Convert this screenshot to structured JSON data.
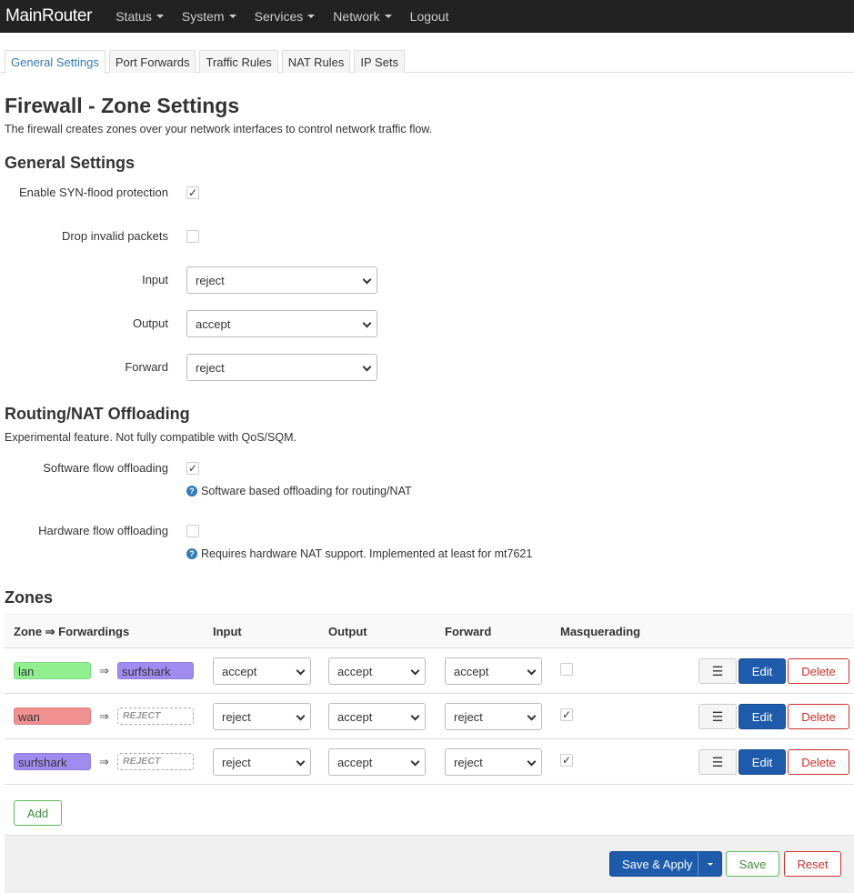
{
  "nav": {
    "brand": "MainRouter",
    "items": [
      "Status",
      "System",
      "Services",
      "Network",
      "Logout"
    ]
  },
  "tabs": [
    "General Settings",
    "Port Forwards",
    "Traffic Rules",
    "NAT Rules",
    "IP Sets"
  ],
  "page": {
    "title": "Firewall - Zone Settings",
    "description": "The firewall creates zones over your network interfaces to control network traffic flow."
  },
  "general": {
    "heading": "General Settings",
    "syn_label": "Enable SYN-flood protection",
    "syn_checked": true,
    "drop_label": "Drop invalid packets",
    "drop_checked": false,
    "input_label": "Input",
    "input_value": "reject",
    "output_label": "Output",
    "output_value": "accept",
    "forward_label": "Forward",
    "forward_value": "reject"
  },
  "offload": {
    "heading": "Routing/NAT Offloading",
    "description": "Experimental feature. Not fully compatible with QoS/SQM.",
    "sw_label": "Software flow offloading",
    "sw_checked": true,
    "sw_help": "Software based offloading for routing/NAT",
    "hw_label": "Hardware flow offloading",
    "hw_checked": false,
    "hw_help": "Requires hardware NAT support. Implemented at least for mt7621"
  },
  "zones": {
    "heading": "Zones",
    "columns": {
      "zone": "Zone ⇒ Forwardings",
      "input": "Input",
      "output": "Output",
      "forward": "Forward",
      "masq": "Masquerading"
    },
    "arrow": "⇒",
    "rows": [
      {
        "name": "lan",
        "color": "#90f090",
        "dest": "surfshark",
        "dest_color": "#a08cf0",
        "input": "accept",
        "output": "accept",
        "forward": "accept",
        "masq": false
      },
      {
        "name": "wan",
        "color": "#f09090",
        "dest": "REJECT",
        "dest_color": "",
        "input": "reject",
        "output": "accept",
        "forward": "reject",
        "masq": true
      },
      {
        "name": "surfshark",
        "color": "#a08cf0",
        "dest": "REJECT",
        "dest_color": "",
        "input": "reject",
        "output": "accept",
        "forward": "reject",
        "masq": true
      }
    ],
    "menu_glyph": "☰",
    "edit_label": "Edit",
    "delete_label": "Delete",
    "add_label": "Add"
  },
  "footer": {
    "save_apply": "Save & Apply",
    "save": "Save",
    "reset": "Reset"
  }
}
